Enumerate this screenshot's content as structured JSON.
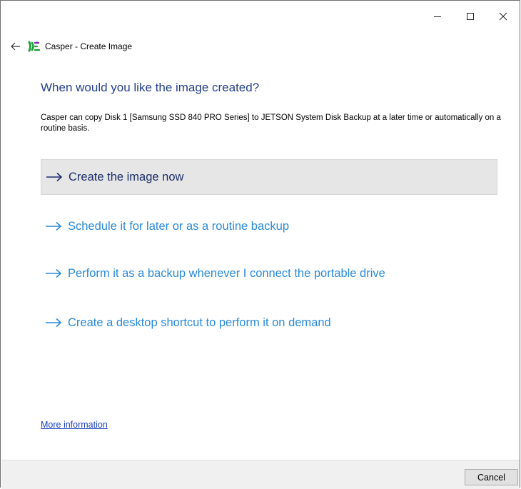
{
  "window": {
    "app_name": "Casper",
    "title_separator": " - ",
    "page_name": "Create Image"
  },
  "icons": {
    "back": "back-arrow-icon",
    "logo": "casper-logo-icon",
    "minimize": "minimize-icon",
    "maximize": "maximize-icon",
    "close": "close-icon",
    "option_arrow": "right-arrow-icon"
  },
  "main": {
    "heading": "When would you like the image created?",
    "description": "Casper can copy Disk 1 [Samsung SSD 840 PRO Series] to JETSON System Disk Backup at a later time or automatically on a routine basis.",
    "options": [
      {
        "label": "Create the image now",
        "selected": true
      },
      {
        "label": "Schedule it for later or as a routine backup",
        "selected": false
      },
      {
        "label": "Perform it as a backup whenever I connect the portable drive",
        "selected": false
      },
      {
        "label": "Create a desktop shortcut to perform it on demand",
        "selected": false
      }
    ],
    "more_info_link": "More information"
  },
  "footer": {
    "cancel_label": "Cancel"
  },
  "colors": {
    "heading": "#233f8c",
    "option_link": "#2a8ad6",
    "option_selected_text": "#1c2d6b",
    "selected_background": "#e6e6e6",
    "footer_background": "#f0f0f0",
    "logo_green": "#1f9e3a",
    "logo_purple": "#7a2fb0"
  }
}
